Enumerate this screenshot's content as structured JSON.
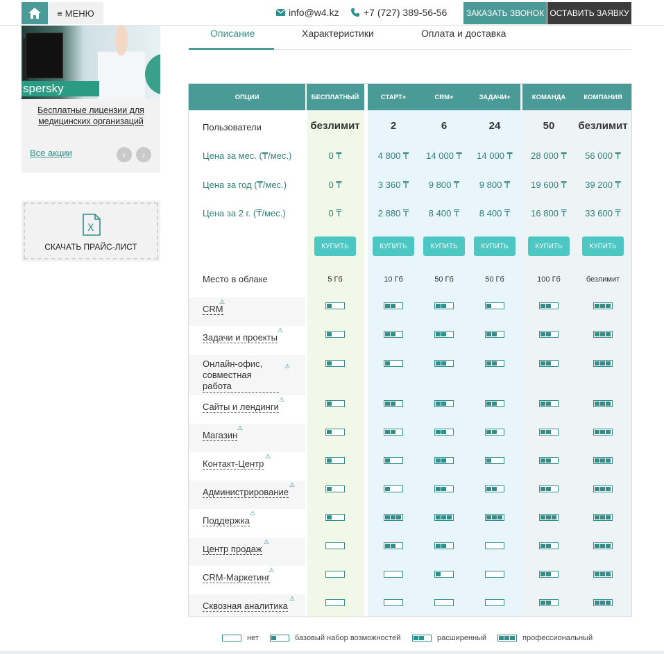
{
  "header": {
    "menu_label": "МЕНЮ",
    "email": "info@w4.kz",
    "phone": "+7 (727) 389-56-56",
    "call_button": "ЗАКАЗАТЬ ЗВОНОК",
    "request_button": "ОСТАВИТЬ ЗАЯВКУ"
  },
  "sidebar": {
    "promo_brand": "spersky",
    "promo_link": "Бесплатные лицензии для медицинских организаций",
    "all_promos": "Все акции",
    "price_list_label": "СКАЧАТЬ ПРАЙС-ЛИСТ"
  },
  "tabs": [
    "Описание",
    "Характеристики",
    "Оплата и доставка"
  ],
  "table": {
    "headers": [
      "ОПЦИИ",
      "БЕСПЛАТНЫЙ",
      "СТАРТ+",
      "CRM+",
      "ЗАДАЧИ+",
      "КОМАНДА",
      "КОМПАНИЯ"
    ],
    "users_label": "Пользователи",
    "users": [
      "безлимит",
      "2",
      "6",
      "24",
      "50",
      "безлимит"
    ],
    "price_rows": [
      {
        "label": "Цена за мес. (₸/мес.)",
        "values": [
          "0 ₸",
          "4 800 ₸",
          "14 000 ₸",
          "14 000 ₸",
          "28 000 ₸",
          "56 000 ₸"
        ]
      },
      {
        "label": "Цена за год (₸/мес.)",
        "values": [
          "0 ₸",
          "3 360 ₸",
          "9 800 ₸",
          "9 800 ₸",
          "19 600 ₸",
          "39 200 ₸"
        ]
      },
      {
        "label": "Цена за 2 г. (₸/мес.)",
        "values": [
          "0 ₸",
          "2 880 ₸",
          "8 400 ₸",
          "8 400 ₸",
          "16 800 ₸",
          "33 600 ₸"
        ]
      }
    ],
    "buy_label": "КУПИТЬ",
    "cloud_label": "Место в облаке",
    "cloud": [
      "5 Гб",
      "10 Гб",
      "50 Гб",
      "50 Гб",
      "100 Гб",
      "безлимит"
    ],
    "features": [
      {
        "label": "CRM",
        "levels": [
          1,
          2,
          2,
          1,
          2,
          3
        ]
      },
      {
        "label": "Задачи и проекты",
        "levels": [
          1,
          2,
          2,
          2,
          2,
          3
        ]
      },
      {
        "label": "Онлайн-офис, совместная работа",
        "levels": [
          1,
          1,
          2,
          2,
          2,
          3
        ]
      },
      {
        "label": "Сайты и лендинги",
        "levels": [
          1,
          2,
          2,
          2,
          2,
          3
        ]
      },
      {
        "label": "Магазин",
        "levels": [
          1,
          2,
          2,
          2,
          2,
          3
        ]
      },
      {
        "label": "Контакт-Центр",
        "levels": [
          1,
          1,
          2,
          1,
          2,
          3
        ]
      },
      {
        "label": "Администрирование",
        "levels": [
          1,
          1,
          2,
          2,
          2,
          3
        ]
      },
      {
        "label": "Поддержка",
        "levels": [
          1,
          3,
          3,
          3,
          3,
          3
        ]
      },
      {
        "label": "Центр продаж",
        "levels": [
          0,
          2,
          2,
          0,
          2,
          3
        ]
      },
      {
        "label": "CRM-Маркетинг",
        "levels": [
          0,
          0,
          1,
          0,
          2,
          3
        ]
      },
      {
        "label": "Сквозная аналитика",
        "levels": [
          0,
          0,
          0,
          0,
          2,
          3
        ]
      }
    ]
  },
  "legend": [
    "нет",
    "базовый набор возможностей",
    "расширенный",
    "профессиональный"
  ]
}
